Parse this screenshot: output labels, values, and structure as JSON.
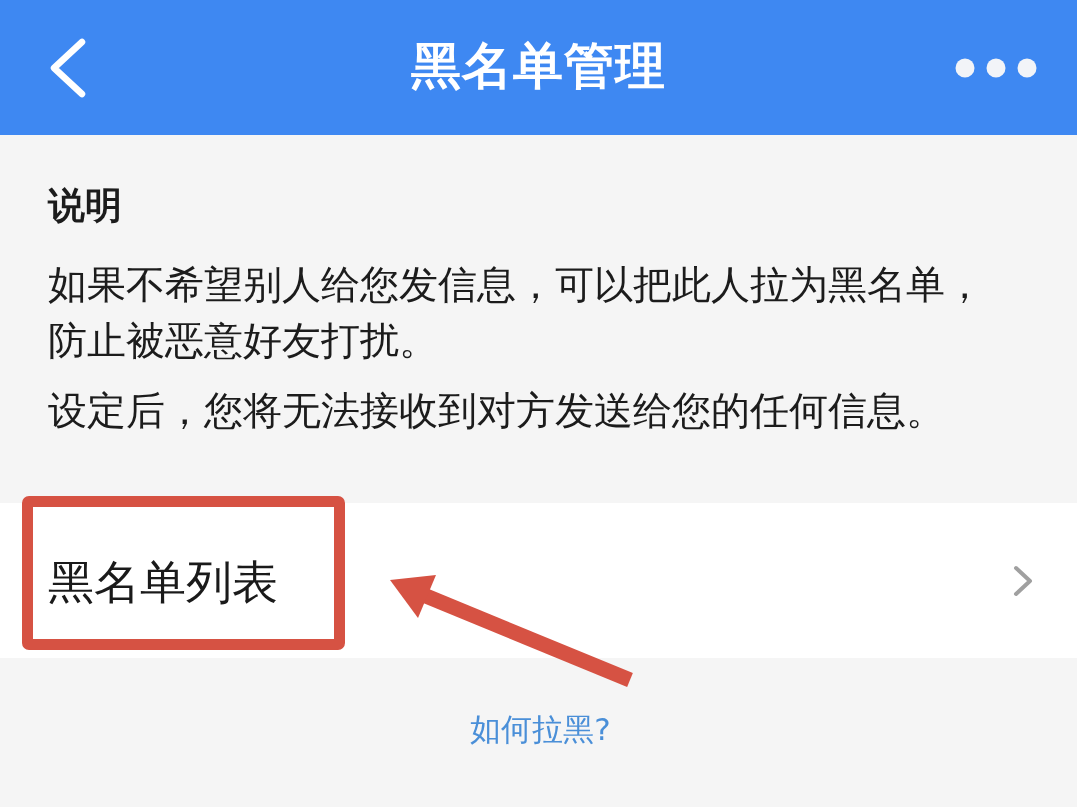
{
  "header": {
    "title": "黑名单管理"
  },
  "description": {
    "heading": "说明",
    "paragraphs": [
      "如果不希望别人给您发信息，可以把此人拉为黑名单，防止被恶意好友打扰。",
      "设定后，您将无法接收到对方发送给您的任何信息。"
    ]
  },
  "menu_items": [
    {
      "label": "黑名单列表",
      "highlighted": true
    }
  ],
  "help_link": "如何拉黑?"
}
